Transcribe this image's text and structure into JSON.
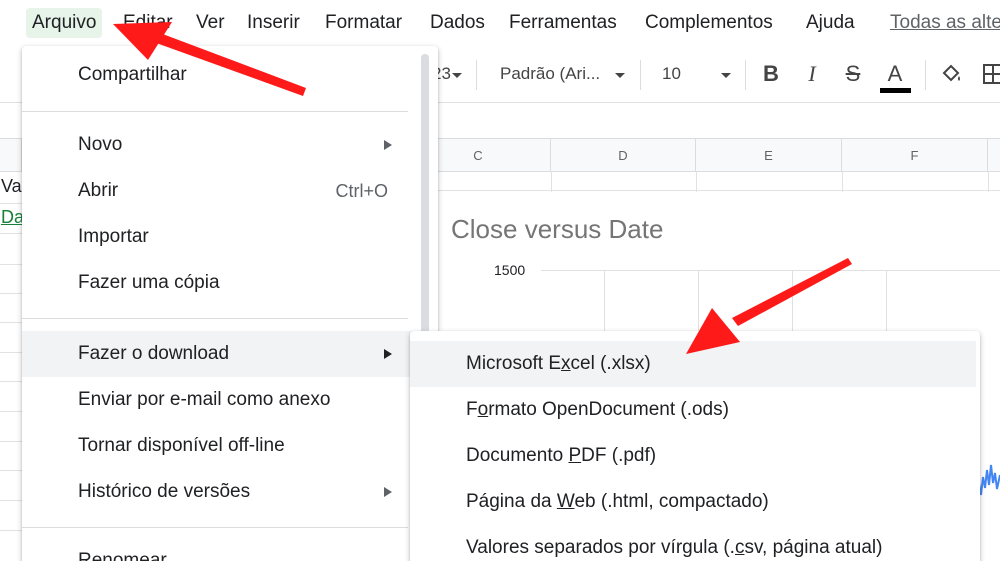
{
  "menubar": {
    "items": [
      {
        "label": "Arquivo",
        "active": true
      },
      {
        "label": "Editar"
      },
      {
        "label": "Ver"
      },
      {
        "label": "Inserir"
      },
      {
        "label": "Formatar"
      },
      {
        "label": "Dados"
      },
      {
        "label": "Ferramentas"
      },
      {
        "label": "Complementos"
      },
      {
        "label": "Ajuda"
      }
    ],
    "last_edit_link": "Todas as alte"
  },
  "toolbar": {
    "number_format": "23",
    "font_name": "Padrão (Ari...",
    "font_size": "10",
    "bold": "B",
    "italic": "I",
    "strikethrough": "S",
    "text_color": "A",
    "text_color_value": "#000000"
  },
  "grid": {
    "columns": [
      "C",
      "D",
      "E",
      "F"
    ],
    "cell_a1": "Va",
    "cell_a2": "Da",
    "cell_a2_color": "#188038"
  },
  "chart": {
    "title": "Close versus Date",
    "y_tick_top": "1500",
    "series_color": "#4285f4"
  },
  "file_menu": {
    "items": [
      {
        "label": "Compartilhar"
      },
      {
        "label": "Novo",
        "submenu": true
      },
      {
        "label": "Abrir",
        "shortcut": "Ctrl+O"
      },
      {
        "label": "Importar"
      },
      {
        "label": "Fazer uma cópia"
      },
      {
        "label": "Fazer o download",
        "submenu": true,
        "hover": true
      },
      {
        "label": "Enviar por e-mail como anexo"
      },
      {
        "label": "Tornar disponível off-line"
      },
      {
        "label": "Histórico de versões",
        "submenu": true
      },
      {
        "label": "Renomear"
      }
    ]
  },
  "download_submenu": {
    "items": [
      {
        "label": "Microsoft Excel (.xlsx)",
        "underline_char": "x",
        "hover": true
      },
      {
        "label": "Formato OpenDocument (.ods)",
        "underline_char": "o"
      },
      {
        "label": "Documento PDF (.pdf)",
        "underline_char": "P"
      },
      {
        "label": "Página da Web (.html, compactado)",
        "underline_char": "W"
      },
      {
        "label": "Valores separados por vírgula (.csv, página atual)",
        "underline_char": "c"
      }
    ]
  },
  "annotation_color": "#ff0000"
}
